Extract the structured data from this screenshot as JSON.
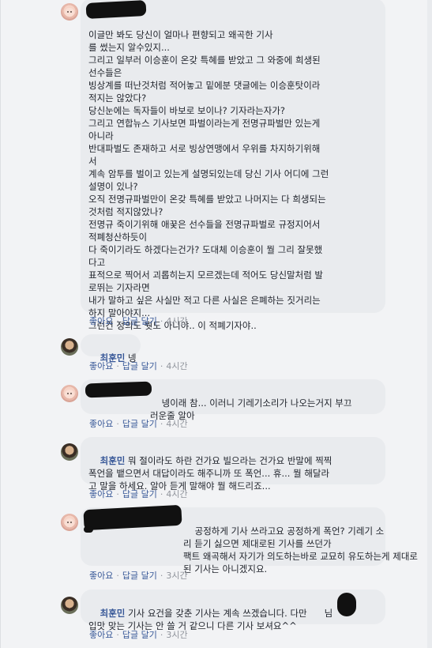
{
  "comments": [
    {
      "author": "",
      "text": "이글만 봐도 당신이 얼마나 편향되고 왜곡한 기사\n를 썼는지 알수있지...\n그리고 일부러 이승훈이 온갖 특혜를 받았고 그 와중에 희생된\n선수들은\n빙상계를 떠난것처럼 적어놓고 밑에분 댓글에는 이승훈탓이라\n적지는 않았다?\n당신눈에는 독자들이 바보로 보이나? 기자라는자가?\n그리고 연합뉴스 기사보면 파벌이라는게 전명규파벌만 있는게\n아니라\n반대파벌도 존재하고 서로 빙상연맹에서 우위를 차지하기위해\n서\n계속 암투를 벌이고 있는게 설명되있는데 당신 기사 어디에 그런\n설명이 있나?\n오직 전명규파벌만이 온갖 특혜를 받았고 나머지는 다 희생되는\n것처럼 적지않았나?\n전명규 죽이기위해 애꿎은 선수들을 전명규파벌로 규정지어서\n적폐청산하듯이\n다 죽이기라도 하겠다는건가? 도대체 이승훈이 뭘 그리 잘못했\n다고\n표적으로 찍어서 괴롭히는지 모르겠는데 적어도 당신말처럼 발\n로뛰는 기자라면\n내가 말하고 싶은 사실만 적고 다른 사실은 은폐하는 짓거리는\n하지 말아야지...\n그런건 정의도 뭣도 아니야.. 이 적폐기자야..",
      "like": "좋아요",
      "reply": "답글 달기",
      "time": "4시간"
    },
    {
      "author": "최훈민",
      "text": "넹",
      "like": "좋아요",
      "reply": "답글 달기",
      "time": "4시간"
    },
    {
      "author": "",
      "text": "넹이래 참... 이러니 기레기소리가 나오는거지 부끄\n러운줄 알아",
      "like": "좋아요",
      "reply": "답글 달기",
      "time": "4시간"
    },
    {
      "author": "최훈민",
      "text": "뭐 절이라도 하란 건가요 빌으라는 건가요 반말에 찍찍\n폭언을 뱉으면서 대답이라도 해주니까 또 폭언... 휴... 뭘 해달라\n고 말을 하세요. 알아 듣게 말해야 뭘 해드리죠...",
      "like": "좋아요",
      "reply": "답글 달기",
      "time": "4시간"
    },
    {
      "author": "",
      "text": "공정하게 기사 쓰라고요 공정하게 폭언? 기레기 소\n리 듣기 싫으면 제대로된 기사를 쓰던가\n팩트 왜곡해서 자기가 의도하는바로 교묘히 유도하는게 제대로\n된 기사는 아니겠지요.",
      "like": "좋아요",
      "reply": "답글 달기",
      "time": "3시간"
    },
    {
      "author": "최훈민",
      "text": "기사 요건을 갖춘 기사는 계속 쓰겠습니다. 다만      님\n입맛 맞는 기사는 안 쓸 거 같으니 다른 기사 보셔요^^",
      "like": "좋아요",
      "reply": "답글 달기",
      "time": "3시간"
    }
  ]
}
